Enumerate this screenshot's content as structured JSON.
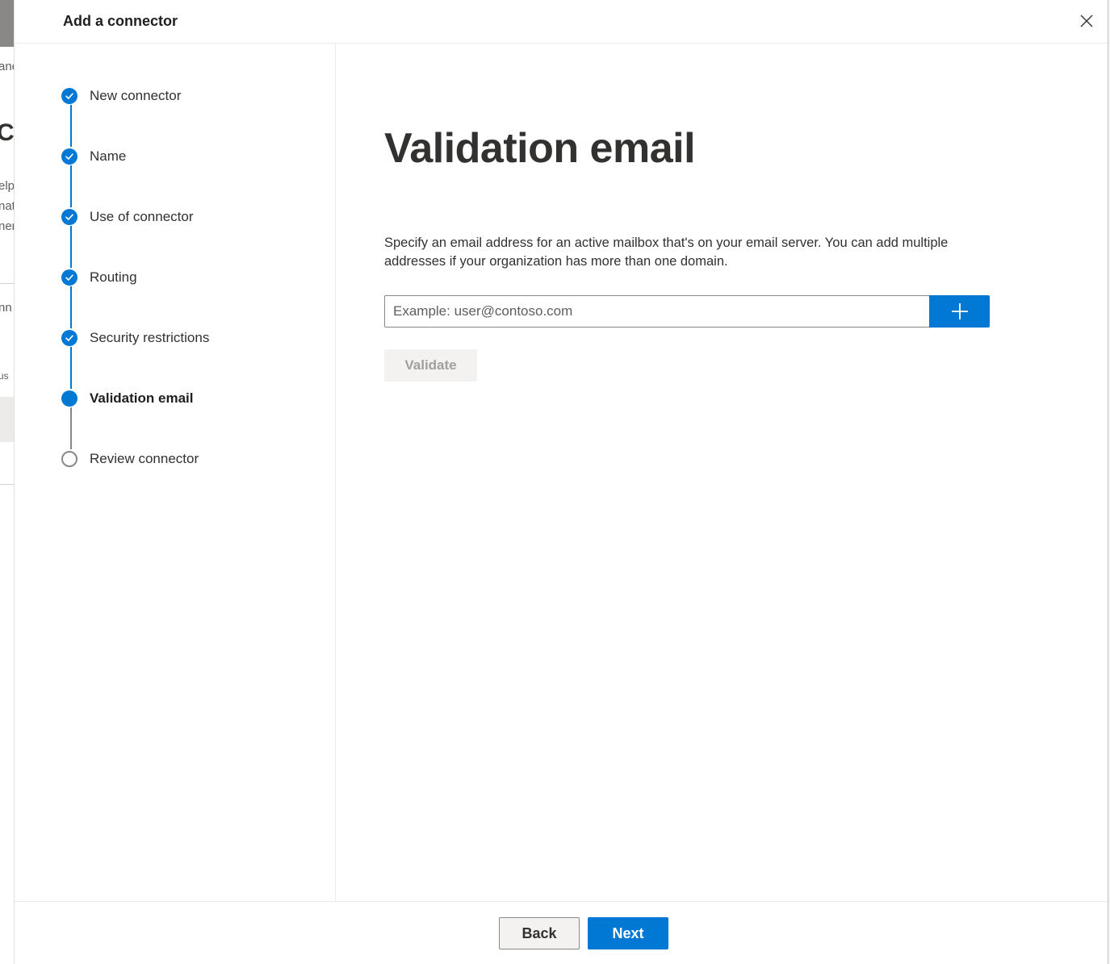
{
  "background_page": {
    "fragments": [
      "ane",
      "C",
      "elp",
      "nat",
      "ner",
      "nn",
      "us"
    ]
  },
  "panel": {
    "title": "Add a connector",
    "close_icon": "close-icon"
  },
  "steps": [
    {
      "label": "New connector",
      "state": "done"
    },
    {
      "label": "Name",
      "state": "done"
    },
    {
      "label": "Use of connector",
      "state": "done"
    },
    {
      "label": "Routing",
      "state": "done"
    },
    {
      "label": "Security restrictions",
      "state": "done"
    },
    {
      "label": "Validation email",
      "state": "current"
    },
    {
      "label": "Review connector",
      "state": "todo"
    }
  ],
  "content": {
    "heading": "Validation email",
    "description": "Specify an email address for an active mailbox that's on your email server. You can add multiple addresses if your organization has more than one domain.",
    "email_input": {
      "value": "",
      "placeholder": "Example: user@contoso.com"
    },
    "add_icon": "plus-icon",
    "validate_label": "Validate"
  },
  "footer": {
    "back_label": "Back",
    "next_label": "Next"
  },
  "colors": {
    "accent": "#0078d4",
    "disabled_text": "#a19f9d",
    "todo_ring": "#8a8886"
  }
}
